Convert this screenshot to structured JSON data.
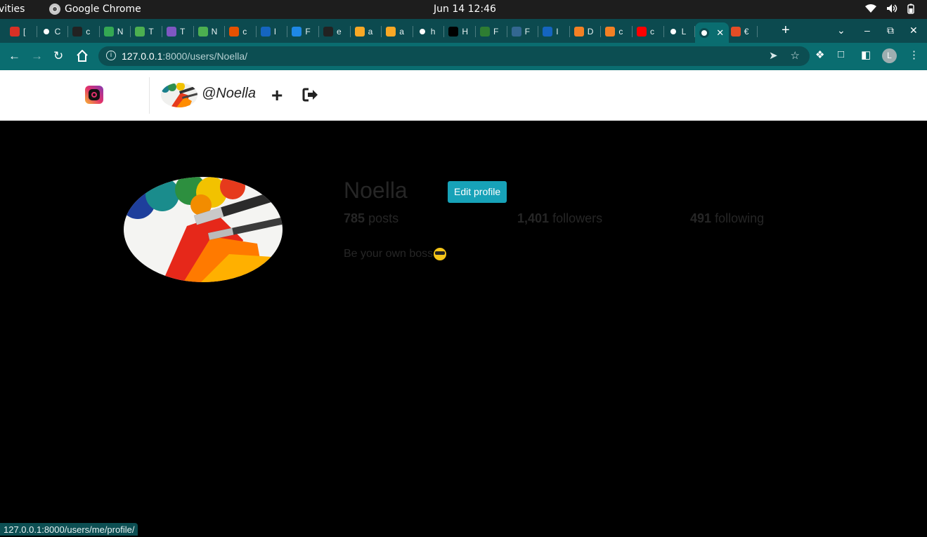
{
  "os_bar": {
    "activities": "vities",
    "app_name": "Google Chrome",
    "clock": "Jun 14  12:46"
  },
  "tabs": [
    {
      "icon": "gmail-icon",
      "label": "[",
      "color": "#d93025"
    },
    {
      "icon": "globe-icon",
      "label": "C",
      "color": "#ffffff"
    },
    {
      "icon": "github-icon",
      "label": "c",
      "color": "#222222"
    },
    {
      "icon": "drive-icon",
      "label": "N",
      "color": "#34a853"
    },
    {
      "icon": "palm-icon",
      "label": "T",
      "color": "#4caf50"
    },
    {
      "icon": "h-icon",
      "label": "T",
      "color": "#7e57c2"
    },
    {
      "icon": "palm-icon",
      "label": "N",
      "color": "#4caf50"
    },
    {
      "icon": "ask-icon",
      "label": "c",
      "color": "#e65100"
    },
    {
      "icon": "chart-icon",
      "label": "I",
      "color": "#1565c0"
    },
    {
      "icon": "loader-icon",
      "label": "F",
      "color": "#1e88e5"
    },
    {
      "icon": "github-icon",
      "label": "e",
      "color": "#222222"
    },
    {
      "icon": "trophy-icon",
      "label": "a",
      "color": "#f9a825"
    },
    {
      "icon": "trophy-icon",
      "label": "a",
      "color": "#f9a825"
    },
    {
      "icon": "google-icon",
      "label": "h",
      "color": "#ffffff"
    },
    {
      "icon": "dev-icon",
      "label": "H",
      "color": "#000000"
    },
    {
      "icon": "shield-icon",
      "label": "F",
      "color": "#2e7d32"
    },
    {
      "icon": "elephant-icon",
      "label": "F",
      "color": "#336791"
    },
    {
      "icon": "atom-icon",
      "label": "I",
      "color": "#1565c0"
    },
    {
      "icon": "stack-icon",
      "label": "D",
      "color": "#f48024"
    },
    {
      "icon": "stack-icon",
      "label": "c",
      "color": "#f48024"
    },
    {
      "icon": "youtube-icon",
      "label": "c",
      "color": "#ff0000"
    },
    {
      "icon": "globe-icon",
      "label": "L",
      "color": "#ffffff"
    },
    {
      "icon": "at-icon",
      "label": "",
      "color": "#ffffff",
      "active": true
    },
    {
      "icon": "html5-icon",
      "label": "€",
      "color": "#e44d26"
    }
  ],
  "address_bar": {
    "host": "127.0.0.1",
    "path": ":8000/users/Noella/"
  },
  "profile_initial": "L",
  "site_nav": {
    "username": "@Noella",
    "add_symbol": "+"
  },
  "profile": {
    "name": "Noella",
    "edit_label": "Edit profile",
    "posts_count": "785",
    "posts_label": "posts",
    "followers_count": "1,401",
    "followers_label": "followers",
    "following_count": "491",
    "following_label": "following",
    "bio": "Be your own boss"
  },
  "status_bar_url": "127.0.0.1:8000/users/me/profile/",
  "colors": {
    "tab_strip": "#0c4a4f",
    "toolbar": "#0a6d70",
    "edit_button": "#17a2b8",
    "page_background": "#000000"
  }
}
